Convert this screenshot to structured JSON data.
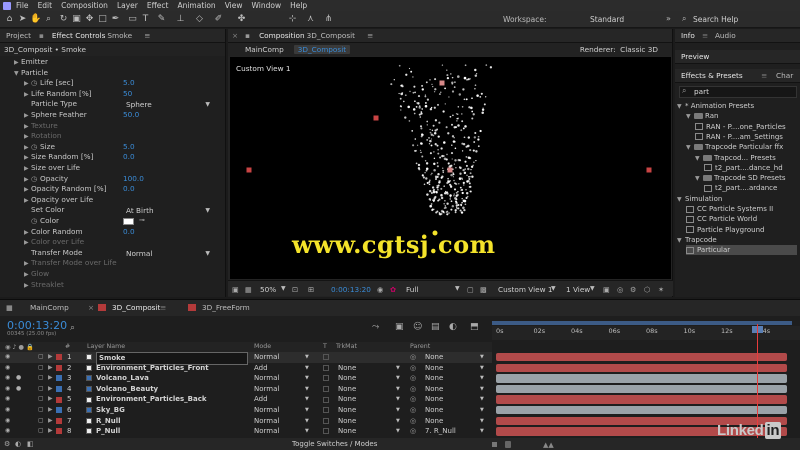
{
  "menu": [
    "File",
    "Edit",
    "Composition",
    "Layer",
    "Effect",
    "Animation",
    "View",
    "Window",
    "Help"
  ],
  "toolbar": {
    "workspace_label": "Workspace:",
    "workspace_value": "Standard",
    "search_help": "Search Help"
  },
  "left_panel": {
    "tabs": [
      "Project",
      "Effect Controls",
      "Smoke"
    ],
    "subtitle": "3D_Composit • Smoke",
    "properties": [
      {
        "label": "Emitter",
        "indent": 1,
        "tri": "▶"
      },
      {
        "label": "Particle",
        "indent": 1,
        "tri": "▼"
      },
      {
        "label": "Life [sec]",
        "indent": 2,
        "tri": "▶",
        "stopwatch": true,
        "value": "5.0"
      },
      {
        "label": "Life Random [%]",
        "indent": 2,
        "tri": "▶",
        "value": "50"
      },
      {
        "label": "Particle Type",
        "indent": 2,
        "dropdown": "Sphere"
      },
      {
        "label": "Sphere Feather",
        "indent": 2,
        "tri": "▶",
        "value": "50.0"
      },
      {
        "label": "Texture",
        "indent": 2,
        "tri": "▶",
        "disabled": true
      },
      {
        "label": "Rotation",
        "indent": 2,
        "tri": "▶",
        "disabled": true
      },
      {
        "label": "Size",
        "indent": 2,
        "tri": "▶",
        "stopwatch": true,
        "value": "5.0"
      },
      {
        "label": "Size Random [%]",
        "indent": 2,
        "tri": "▶",
        "value": "0.0"
      },
      {
        "label": "Size over Life",
        "indent": 2,
        "tri": "▶"
      },
      {
        "label": "Opacity",
        "indent": 2,
        "tri": "▶",
        "stopwatch": true,
        "value": "100.0"
      },
      {
        "label": "Opacity Random [%]",
        "indent": 2,
        "tri": "▶",
        "value": "0.0"
      },
      {
        "label": "Opacity over Life",
        "indent": 2,
        "tri": "▶"
      },
      {
        "label": "Set Color",
        "indent": 2,
        "dropdown": "At Birth"
      },
      {
        "label": "Color",
        "indent": 2,
        "stopwatch": true,
        "color": "#ffffff"
      },
      {
        "label": "Color Random",
        "indent": 2,
        "tri": "▶",
        "value": "0.0"
      },
      {
        "label": "Color over Life",
        "indent": 2,
        "tri": "▶",
        "disabled": true
      },
      {
        "label": "Transfer Mode",
        "indent": 2,
        "dropdown": "Normal"
      },
      {
        "label": "Transfer Mode over Life",
        "indent": 2,
        "tri": "▶",
        "disabled": true
      },
      {
        "label": "Glow",
        "indent": 2,
        "tri": "▶",
        "disabled": true
      },
      {
        "label": "Streaklet",
        "indent": 2,
        "tri": "▶",
        "disabled": true
      }
    ]
  },
  "comp_panel": {
    "tab": "Composition",
    "tab_name": "3D_Composit",
    "breadcrumbs": [
      "MainComp",
      "3D_Composit"
    ],
    "renderer_label": "Renderer:",
    "renderer_value": "Classic 3D",
    "view_label": "Custom View 1",
    "watermark": "www.cgtsj.com",
    "zoom": "50%",
    "timecode": "0:00:13:20",
    "resolution": "Full",
    "view_select": "Custom View 1",
    "views": "1 View"
  },
  "right_panel": {
    "tabs_top": [
      "Info",
      "Audio"
    ],
    "preview": "Preview",
    "effects_tab": "Effects & Presets",
    "effects_tab2": "Char",
    "search": "part",
    "tree": [
      {
        "label": "* Animation Presets",
        "level": 0,
        "type": "open"
      },
      {
        "label": "Ran",
        "level": 1,
        "type": "folder"
      },
      {
        "label": "RAN - P....one_Particles",
        "level": 2,
        "type": "fx"
      },
      {
        "label": "RAN - P....am_Settings",
        "level": 2,
        "type": "fx"
      },
      {
        "label": "Trapcode Particular ffx",
        "level": 1,
        "type": "folder"
      },
      {
        "label": "Trapcod... Presets",
        "level": 2,
        "type": "folder"
      },
      {
        "label": "t2_part....dance_hd",
        "level": 3,
        "type": "fx"
      },
      {
        "label": "Trapcode SD Presets",
        "level": 2,
        "type": "folder"
      },
      {
        "label": "t2_part....ardance",
        "level": 3,
        "type": "fx"
      },
      {
        "label": "Simulation",
        "level": 0,
        "type": "open"
      },
      {
        "label": "CC Particle Systems II",
        "level": 1,
        "type": "fx"
      },
      {
        "label": "CC Particle World",
        "level": 1,
        "type": "fx"
      },
      {
        "label": "Particle Playground",
        "level": 1,
        "type": "fx"
      },
      {
        "label": "Trapcode",
        "level": 0,
        "type": "open"
      },
      {
        "label": "Particular",
        "level": 1,
        "type": "fx",
        "highlight": true
      }
    ]
  },
  "timeline": {
    "tabs": [
      "MainComp",
      "3D_Composit",
      "3D_FreeForm"
    ],
    "timecode": "0:00:13:20",
    "fps": "00345 (25.00 fps)",
    "columns": {
      "num": "#",
      "layer": "Layer Name",
      "mode": "Mode",
      "t": "T",
      "trkmat": "TrkMat",
      "parent": "Parent"
    },
    "ruler": [
      "0s",
      "02s",
      "04s",
      "06s",
      "08s",
      "10s",
      "12s",
      "14s"
    ],
    "layers": [
      {
        "num": "1",
        "name": "Smoke",
        "mode": "Normal",
        "trkmat": "",
        "parent": "None",
        "color": "#b33a3a",
        "bar": "#b24a4a",
        "solid": true
      },
      {
        "num": "2",
        "name": "Environment_Particles_Front",
        "mode": "Add",
        "trkmat": "None",
        "parent": "None",
        "color": "#b33a3a",
        "bar": "#b24a4a",
        "solid": true
      },
      {
        "num": "3",
        "name": "Volcano_Lava",
        "mode": "Normal",
        "trkmat": "None",
        "parent": "None",
        "color": "#3a6fb3",
        "bar": "#9aa2a8",
        "solid": false
      },
      {
        "num": "4",
        "name": "Volcano_Beauty",
        "mode": "Normal",
        "trkmat": "None",
        "parent": "None",
        "color": "#3a6fb3",
        "bar": "#9aa2a8",
        "solid": false
      },
      {
        "num": "5",
        "name": "Environment_Particles_Back",
        "mode": "Add",
        "trkmat": "None",
        "parent": "None",
        "color": "#b33a3a",
        "bar": "#b24a4a",
        "solid": true
      },
      {
        "num": "6",
        "name": "Sky_BG",
        "mode": "Normal",
        "trkmat": "None",
        "parent": "None",
        "color": "#3a6fb3",
        "bar": "#9aa2a8",
        "solid": false
      },
      {
        "num": "7",
        "name": "R_Null",
        "mode": "Normal",
        "trkmat": "None",
        "parent": "None",
        "color": "#b33a3a",
        "bar": "#b24a4a",
        "solid": true
      },
      {
        "num": "8",
        "name": "P_Null",
        "mode": "Normal",
        "trkmat": "None",
        "parent": "7. R_Null",
        "color": "#b33a3a",
        "bar": "#b24a4a",
        "solid": true
      }
    ],
    "toggle_label": "Toggle Switches / Modes"
  },
  "brand": {
    "text": "Linked",
    "in": "in"
  },
  "colors": {
    "accent": "#3a8bd6",
    "label_red": "#b33a3a",
    "label_blue": "#3a6fb3",
    "watermark": "#f4e32a"
  }
}
